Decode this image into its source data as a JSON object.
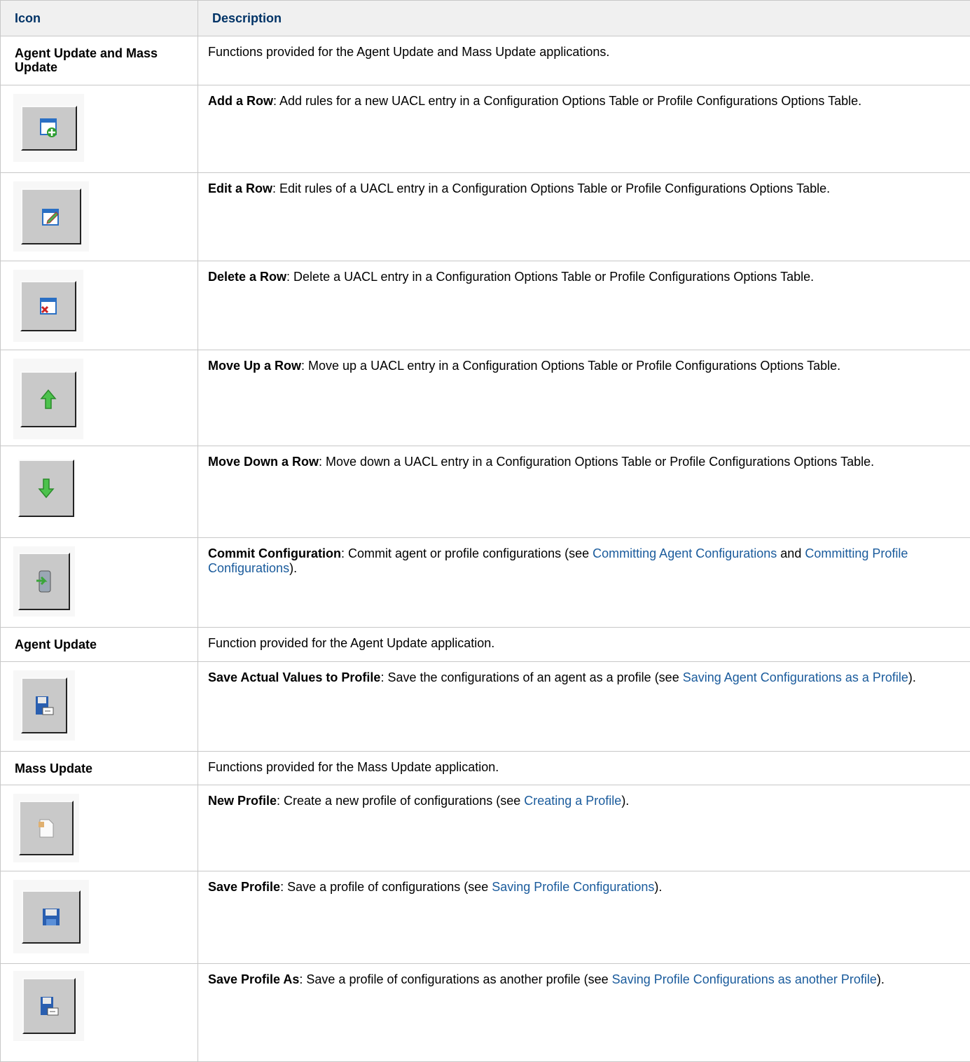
{
  "header": {
    "icon": "Icon",
    "description": "Description"
  },
  "sections": {
    "both": {
      "label": "Agent Update and Mass Update",
      "desc": "Functions provided for the Agent Update and Mass Update applications."
    },
    "agent": {
      "label": "Agent Update",
      "desc": "Function provided for the Agent Update application."
    },
    "mass": {
      "label": "Mass Update",
      "desc": "Functions provided for the Mass Update application."
    }
  },
  "rows": {
    "add": {
      "icon": "add-row-icon",
      "title": "Add a Row",
      "text": ": Add rules for a new UACL entry in a Configuration Options Table or Profile Configurations Options Table."
    },
    "edit": {
      "icon": "edit-row-icon",
      "title": "Edit a Row",
      "text": ": Edit rules of a UACL entry in a Configuration Options Table or Profile Configurations Options Table."
    },
    "delete": {
      "icon": "delete-row-icon",
      "title": "Delete a Row",
      "text": ": Delete a UACL entry in a Configuration Options Table or Profile Configurations Options Table."
    },
    "up": {
      "icon": "move-up-icon",
      "title": "Move Up a Row",
      "text": ": Move up a UACL entry in a Configuration Options Table or Profile Configurations Options Table."
    },
    "down": {
      "icon": "move-down-icon",
      "title": "Move Down a Row",
      "text": ": Move down a UACL entry in a Configuration Options Table or Profile Configurations Options Table."
    },
    "commit": {
      "icon": "commit-icon",
      "title": "Commit Configuration",
      "text": ": Commit agent or profile configurations (see ",
      "link1": "Committing Agent Configurations",
      "mid": " and ",
      "link2": "Committing Profile Configurations",
      "end": ")."
    },
    "saveActual": {
      "icon": "save-actual-icon",
      "title": "Save Actual Values to Profile",
      "text": ": Save the configurations of an agent as a profile (see ",
      "link1": "Saving Agent Configurations as a Profile",
      "end": ")."
    },
    "newProfile": {
      "icon": "new-profile-icon",
      "title": "New Profile",
      "text": ": Create a new profile of configurations (see ",
      "link1": "Creating a Profile",
      "end": ")."
    },
    "saveProfile": {
      "icon": "save-profile-icon",
      "title": "Save Profile",
      "text": ": Save a profile of configurations (see ",
      "link1": "Saving Profile Configurations",
      "end": ")."
    },
    "saveAs": {
      "icon": "save-profile-as-icon",
      "title": "Save Profile As",
      "text": ": Save a profile of configurations as another profile (see ",
      "link1": "Saving Profile Configurations as another Profile",
      "end": ")."
    }
  },
  "colors": {
    "header_text": "#003366",
    "link": "#1a5b9c",
    "border": "#c8c8c8",
    "header_bg": "#f0f0f0"
  }
}
